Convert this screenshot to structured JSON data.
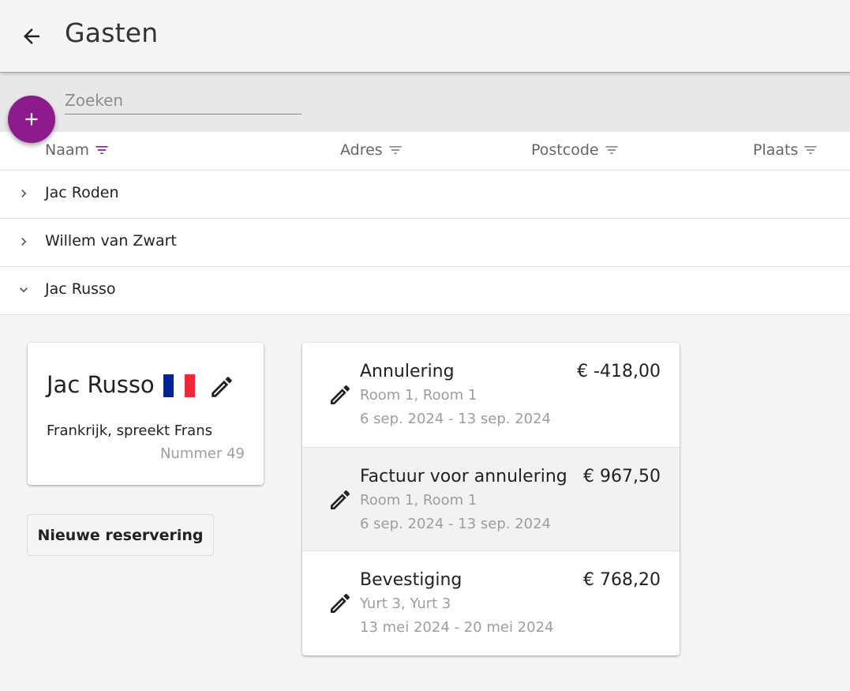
{
  "header": {
    "title": "Gasten"
  },
  "search": {
    "placeholder": "Zoeken"
  },
  "colors": {
    "accent": "#8e1b8e",
    "flag_blue": "#002395",
    "flag_white": "#ffffff",
    "flag_red": "#ed2939"
  },
  "table": {
    "columns": [
      {
        "label": "Naam",
        "sorted": true
      },
      {
        "label": "Adres",
        "sorted": false
      },
      {
        "label": "Postcode",
        "sorted": false
      },
      {
        "label": "Plaats",
        "sorted": false
      }
    ],
    "rows": [
      {
        "name": "Jac Roden",
        "expanded": false
      },
      {
        "name": "Willem van Zwart",
        "expanded": false
      },
      {
        "name": "Jac Russo",
        "expanded": true
      }
    ]
  },
  "guest": {
    "name": "Jac Russo",
    "flag_icon": "france-flag-icon",
    "info": "Frankrijk, spreekt Frans",
    "number": "Nummer 49"
  },
  "new_reservation_label": "Nieuwe reservering",
  "reservations": [
    {
      "title": "Annulering",
      "amount": "€ -418,00",
      "rooms": "Room 1, Room 1",
      "dates": "6 sep. 2024 - 13 sep. 2024"
    },
    {
      "title": "Factuur voor annulering",
      "amount": "€ 967,50",
      "rooms": "Room 1, Room 1",
      "dates": "6 sep. 2024 - 13 sep. 2024"
    },
    {
      "title": "Bevestiging",
      "amount": "€ 768,20",
      "rooms": "Yurt 3, Yurt 3",
      "dates": "13 mei 2024 - 20 mei 2024"
    }
  ]
}
